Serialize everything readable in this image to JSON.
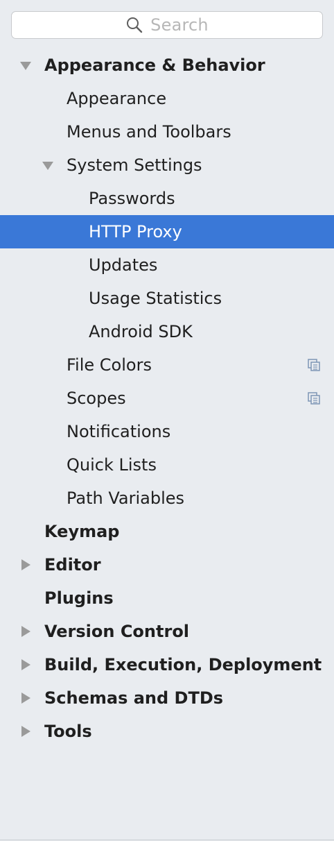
{
  "search": {
    "placeholder": "Search"
  },
  "tree": {
    "appearance_behavior": {
      "label": "Appearance & Behavior",
      "expanded": true
    },
    "appearance": {
      "label": "Appearance"
    },
    "menus_toolbars": {
      "label": "Menus and Toolbars"
    },
    "system_settings": {
      "label": "System Settings",
      "expanded": true
    },
    "passwords": {
      "label": "Passwords"
    },
    "http_proxy": {
      "label": "HTTP Proxy",
      "selected": true
    },
    "updates": {
      "label": "Updates"
    },
    "usage_statistics": {
      "label": "Usage Statistics"
    },
    "android_sdk": {
      "label": "Android SDK"
    },
    "file_colors": {
      "label": "File Colors",
      "icon": "copy-icon"
    },
    "scopes": {
      "label": "Scopes",
      "icon": "copy-icon"
    },
    "notifications": {
      "label": "Notifications"
    },
    "quick_lists": {
      "label": "Quick Lists"
    },
    "path_variables": {
      "label": "Path Variables"
    },
    "keymap": {
      "label": "Keymap"
    },
    "editor": {
      "label": "Editor",
      "expanded": false
    },
    "plugins": {
      "label": "Plugins"
    },
    "version_control": {
      "label": "Version Control",
      "expanded": false
    },
    "build_execution_deployment": {
      "label": "Build, Execution, Deployment",
      "expanded": false
    },
    "schemas_dtds": {
      "label": "Schemas and DTDs",
      "expanded": false
    },
    "tools": {
      "label": "Tools",
      "expanded": false
    }
  },
  "colors": {
    "background": "#e9ecf0",
    "selection": "#3a78d7",
    "text": "#1f1f1f",
    "arrow": "#9a9a9a"
  }
}
